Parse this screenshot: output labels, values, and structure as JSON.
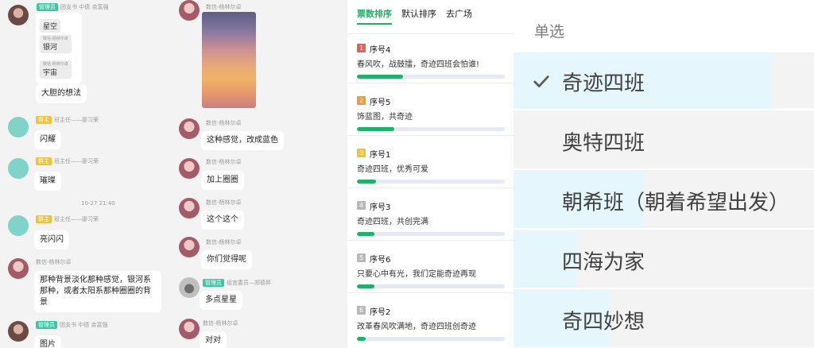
{
  "chat_left": {
    "m1": {
      "badge": "管理员",
      "meta": "团支书  中德 余富强",
      "quotes": [
        {
          "meta": "",
          "text": "星空"
        },
        {
          "meta": "数信-杨林尔卓",
          "text": "银河"
        },
        {
          "meta": "数信-杨林尔卓",
          "text": "宇宙"
        }
      ],
      "text": "大胆的想法"
    },
    "m2": {
      "badge": "群主",
      "meta": "班主任——廖习荣",
      "text": "闪耀"
    },
    "m3": {
      "badge": "群主",
      "meta": "班主任——廖习荣",
      "text": "璀璨"
    },
    "time": "10-27 21:40",
    "m4": {
      "badge": "群主",
      "meta": "班主任——廖习荣",
      "text": "亮闪闪"
    },
    "m5": {
      "meta": "数信-杨林尔卓",
      "text": "那种背景淡化那种感觉，银河系那种，或者太阳系那种圈圈的背景"
    },
    "m6": {
      "badge": "管理员",
      "meta": "团支书  中德 余富强",
      "text": "图片"
    }
  },
  "chat_mid": {
    "m1": {
      "meta": "数信-杨林尔卓"
    },
    "m2": {
      "meta": "数信-杨林尔卓",
      "text": "这种感觉，改成蓝色"
    },
    "m3": {
      "meta": "数信-杨林尔卓",
      "text": "加上圈圈"
    },
    "m4": {
      "meta": "数信-杨林尔卓",
      "text": "这个这个"
    },
    "m5": {
      "meta": "数信-杨林尔卓",
      "text": "你们觉得呢"
    },
    "m6": {
      "badge": "管理员",
      "meta": "组宣委员—郑德昇",
      "text": "多点星星"
    },
    "m7": {
      "meta": "数信-杨林尔卓",
      "text": "对对"
    }
  },
  "vote": {
    "tabs": [
      "票数排序",
      "默认排序",
      "去广场"
    ],
    "items": [
      {
        "rank": "1",
        "title": "序号4",
        "desc": "春风吹，战鼓擂，奇迹四班会怕谁!",
        "progress": 0.31
      },
      {
        "rank": "2",
        "title": "序号5",
        "desc": "饰蓝图，共奇迹",
        "progress": 0.25
      },
      {
        "rank": "3",
        "title": "序号1",
        "desc": "奇迹四班，优秀可爱",
        "progress": 0.13
      },
      {
        "rank": "4",
        "title": "序号3",
        "desc": "奇迹四班，共创完满",
        "progress": 0.12
      },
      {
        "rank": "5",
        "title": "序号6",
        "desc": "只要心中有光，我们定能奇迹再现",
        "progress": 0.12
      },
      {
        "rank": "6",
        "title": "序号2",
        "desc": "改革春风吹满地，奇迹四班创奇迹",
        "progress": 0.06
      }
    ]
  },
  "choice": {
    "title": "单选",
    "options": [
      {
        "label": "奇迹四班",
        "selected": true,
        "fill": 0.86
      },
      {
        "label": "奥特四班",
        "selected": false,
        "fill": 0.0
      },
      {
        "label": "朝希班（朝着希望出发）",
        "selected": false,
        "fill": 0.43
      },
      {
        "label": "四海为家",
        "selected": false,
        "fill": 0.21
      },
      {
        "label": "奇四妙想",
        "selected": false,
        "fill": 0.32
      }
    ],
    "colors": {
      "fill": "#e5f6fc",
      "check": "#5a5a5a"
    }
  }
}
